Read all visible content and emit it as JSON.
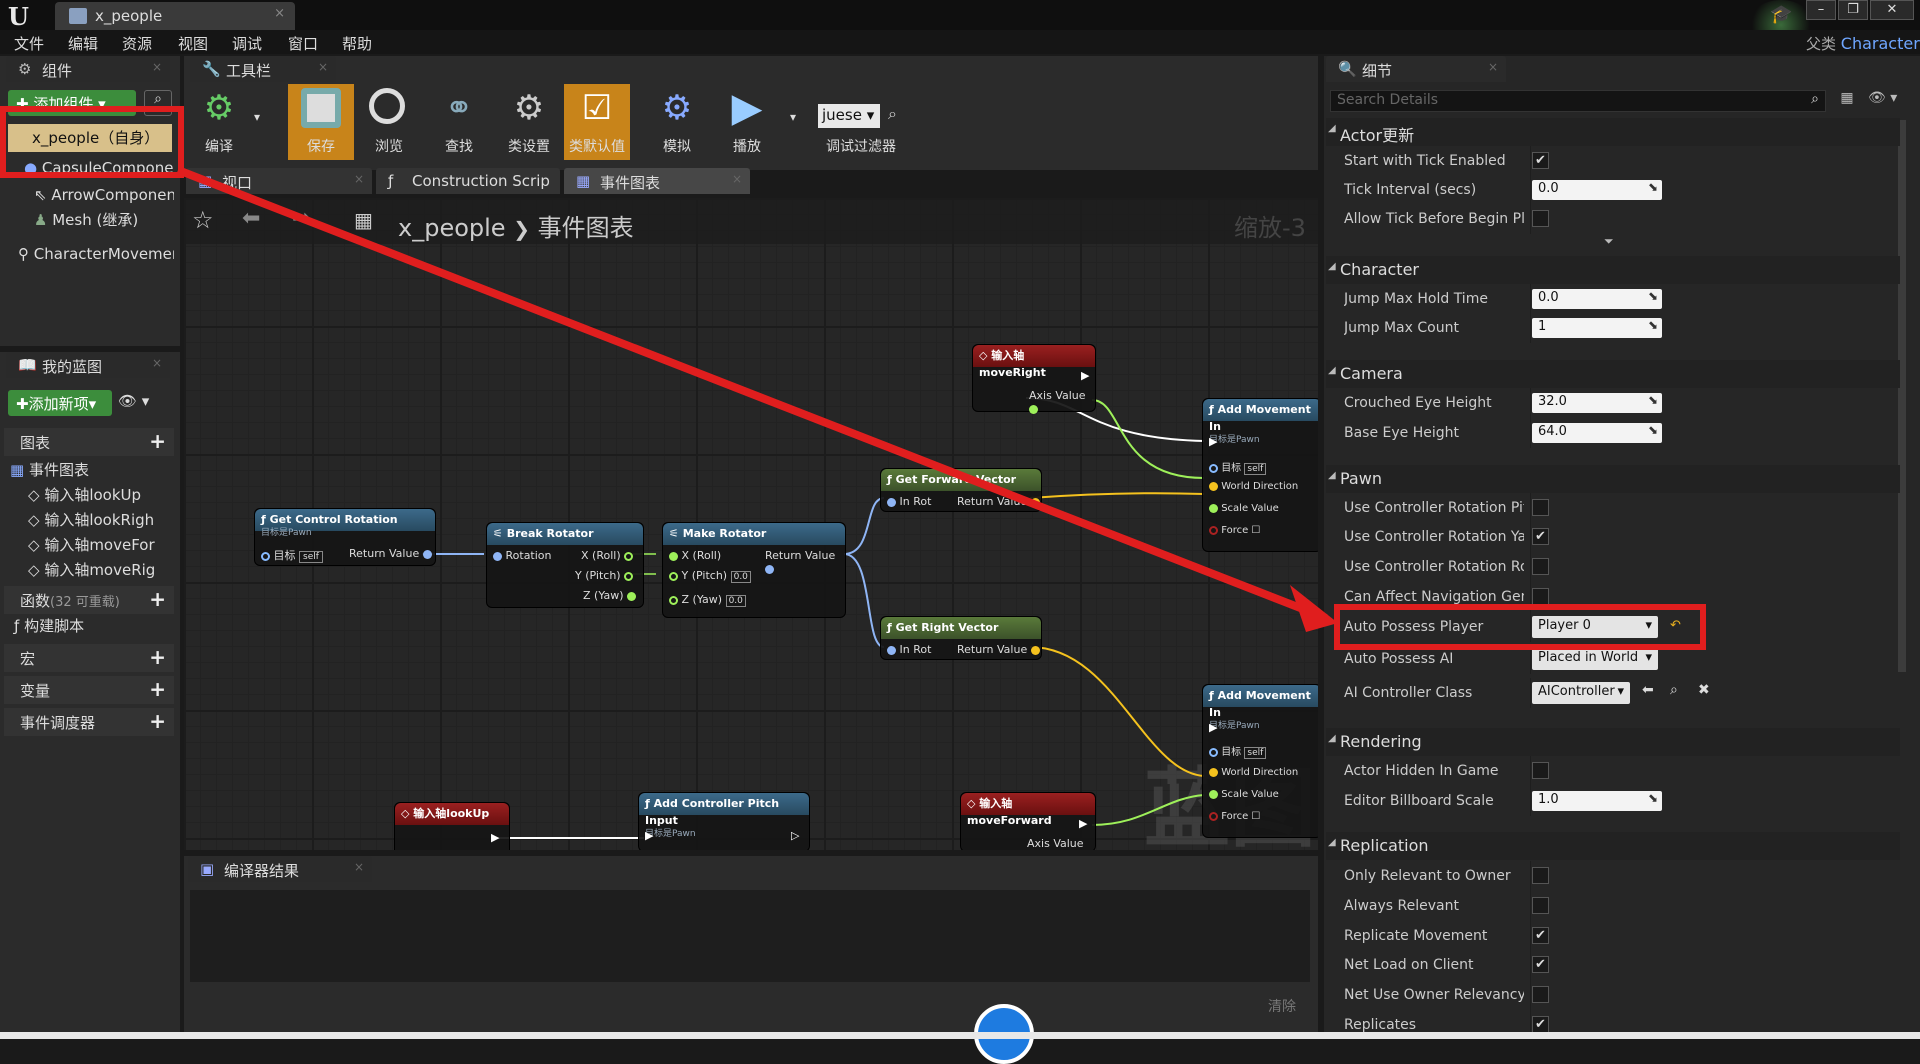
{
  "window": {
    "tab_title": "x_people",
    "parent_label": "父类",
    "parent_class": "Character"
  },
  "menu": [
    "文件",
    "编辑",
    "资源",
    "视图",
    "调试",
    "窗口",
    "帮助"
  ],
  "components": {
    "tab": "组件",
    "add_button": "添加组件",
    "items": [
      "x_people（自身）",
      "CapsuleComponent",
      "ArrowComponent",
      "Mesh (继承)",
      "CharacterMovement"
    ]
  },
  "toolbar_tab": "工具栏",
  "toolbar": [
    "编译",
    "保存",
    "浏览",
    "查找",
    "类设置",
    "类默认值",
    "模拟",
    "播放"
  ],
  "debug_filter": {
    "value": "juese",
    "label": "调试过滤器"
  },
  "my_blueprint": {
    "tab": "我的蓝图",
    "add_button": "添加新项",
    "graphs_header": "图表",
    "event_graph": "事件图表",
    "events": [
      "输入轴lookUp",
      "输入轴lookRigh",
      "输入轴moveFor",
      "输入轴moveRig"
    ],
    "functions_header": "函数",
    "functions_count": "(32 可重载)",
    "construction": "构建脚本",
    "macros": "宏",
    "variables": "变量",
    "dispatchers": "事件调度器"
  },
  "graph_tabs": [
    "视口",
    "Construction Scrip",
    "事件图表"
  ],
  "breadcrumb": {
    "root": "x_people",
    "current": "事件图表",
    "zoom": "缩放-3"
  },
  "watermark": "蓝图",
  "nodes": {
    "get_control_rotation": {
      "title": "Get Control Rotation",
      "sub": "目标是Pawn",
      "target": "目标",
      "self": "self",
      "ret": "Return Value"
    },
    "break_rotator": {
      "title": "Break Rotator",
      "rotation": "Rotation",
      "x": "X (Roll)",
      "y": "Y (Pitch)",
      "z": "Z (Yaw)"
    },
    "make_rotator": {
      "title": "Make Rotator",
      "x": "X (Roll)",
      "y": "Y (Pitch)",
      "z": "Z (Yaw)",
      "ret": "Return Value",
      "zero": "0.0"
    },
    "get_forward": {
      "title": "Get Forward Vector",
      "in": "In Rot",
      "ret": "Return Value"
    },
    "get_right": {
      "title": "Get Right Vector",
      "in": "In Rot",
      "ret": "Return Value"
    },
    "move_right": {
      "title": "输入轴moveRight",
      "axis": "Axis Value"
    },
    "move_forward": {
      "title": "输入轴moveForward",
      "axis": "Axis Value"
    },
    "look_up": {
      "title": "输入轴lookUp"
    },
    "pitch_input": {
      "title": "Add Controller Pitch Input",
      "sub": "目标是Pawn"
    },
    "add_move1": {
      "title": "Add Movement In",
      "sub": "目标是Pawn",
      "target": "目标",
      "self": "self",
      "dir": "World Direction",
      "scale": "Scale Value",
      "force": "Force"
    },
    "add_move2": {
      "title": "Add Movement In",
      "sub": "目标是Pawn",
      "target": "目标",
      "self": "self",
      "dir": "World Direction",
      "scale": "Scale Value",
      "force": "Force"
    }
  },
  "compiler": {
    "tab": "编译器结果",
    "clear": "清除"
  },
  "details": {
    "tab": "细节",
    "search_placeholder": "Search Details",
    "actor_tick": {
      "header": "Actor更新",
      "start_tick": "Start with Tick Enabled",
      "tick_interval": "Tick Interval (secs)",
      "tick_value": "0.0",
      "allow_tick": "Allow Tick Before Begin Pla"
    },
    "character": {
      "header": "Character",
      "jump_hold": "Jump Max Hold Time",
      "jump_hold_v": "0.0",
      "jump_count": "Jump Max Count",
      "jump_count_v": "1"
    },
    "camera": {
      "header": "Camera",
      "crouched": "Crouched Eye Height",
      "crouched_v": "32.0",
      "base_eye": "Base Eye Height",
      "base_eye_v": "64.0"
    },
    "pawn": {
      "header": "Pawn",
      "ucr_pitch": "Use Controller Rotation Pitc",
      "ucr_yaw": "Use Controller Rotation Yav",
      "ucr_roll": "Use Controller Rotation Roll",
      "can_affect": "Can Affect Navigation Gene",
      "auto_player": "Auto Possess Player",
      "auto_player_v": "Player 0",
      "auto_ai": "Auto Possess AI",
      "auto_ai_v": "Placed in World",
      "ai_class": "AI Controller Class",
      "ai_class_v": "AIController"
    },
    "rendering": {
      "header": "Rendering",
      "hidden": "Actor Hidden In Game",
      "billboard": "Editor Billboard Scale",
      "billboard_v": "1.0"
    },
    "replication": {
      "header": "Replication",
      "only_relevant": "Only Relevant to Owner",
      "always": "Always Relevant",
      "rep_move": "Replicate Movement",
      "net_load": "Net Load on Client",
      "net_owner": "Net Use Owner Relevancy",
      "replicates": "Replicates"
    }
  },
  "colors": {
    "accent": "#e01e1e",
    "selected": "#c8841a",
    "exec_pin": "#ffffff",
    "float_pin": "#9ef05a",
    "vector_pin": "#f5c21e",
    "rotator_pin": "#8fb5f5"
  }
}
